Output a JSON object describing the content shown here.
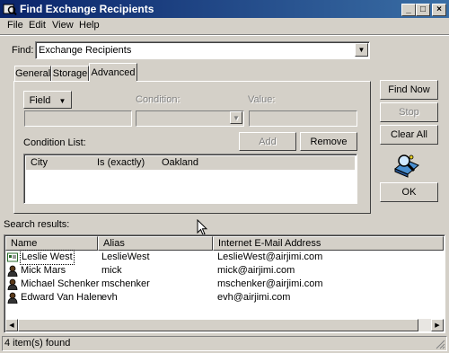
{
  "window": {
    "title": "Find Exchange Recipients",
    "buttons": {
      "minimize": "_",
      "maximize": "□",
      "close": "×"
    }
  },
  "menu": [
    "File",
    "Edit",
    "View",
    "Help"
  ],
  "find": {
    "label": "Find:",
    "value": "Exchange Recipients"
  },
  "tabs": [
    "General",
    "Storage",
    "Advanced"
  ],
  "active_tab": "Advanced",
  "advanced": {
    "field_button": "Field",
    "condition_label": "Condition:",
    "value_label": "Value:",
    "add_button": "Add",
    "remove_button": "Remove",
    "condition_list_label": "Condition List:",
    "conditions": [
      {
        "field": "City",
        "condition": "Is (exactly)",
        "value": "Oakland"
      }
    ]
  },
  "actions": {
    "find_now": "Find Now",
    "stop": "Stop",
    "clear_all": "Clear All",
    "ok": "OK"
  },
  "results": {
    "label": "Search results:",
    "columns": [
      "Name",
      "Alias",
      "Internet E-Mail Address"
    ],
    "rows": [
      {
        "name": "Leslie West",
        "alias": "LeslieWest",
        "email": "LeslieWest@airjimi.com",
        "icon": "contact-card-icon"
      },
      {
        "name": "Mick Mars",
        "alias": "mick",
        "email": "mick@airjimi.com",
        "icon": "user-icon"
      },
      {
        "name": "Michael Schenker",
        "alias": "mschenker",
        "email": "mschenker@airjimi.com",
        "icon": "user-icon"
      },
      {
        "name": "Edward Van Halen",
        "alias": "evh",
        "email": "evh@airjimi.com",
        "icon": "user-icon"
      }
    ]
  },
  "status": "4 item(s) found",
  "colors": {
    "title_start": "#0a246a",
    "title_end": "#3a6ea5",
    "face": "#d4d0c8"
  }
}
